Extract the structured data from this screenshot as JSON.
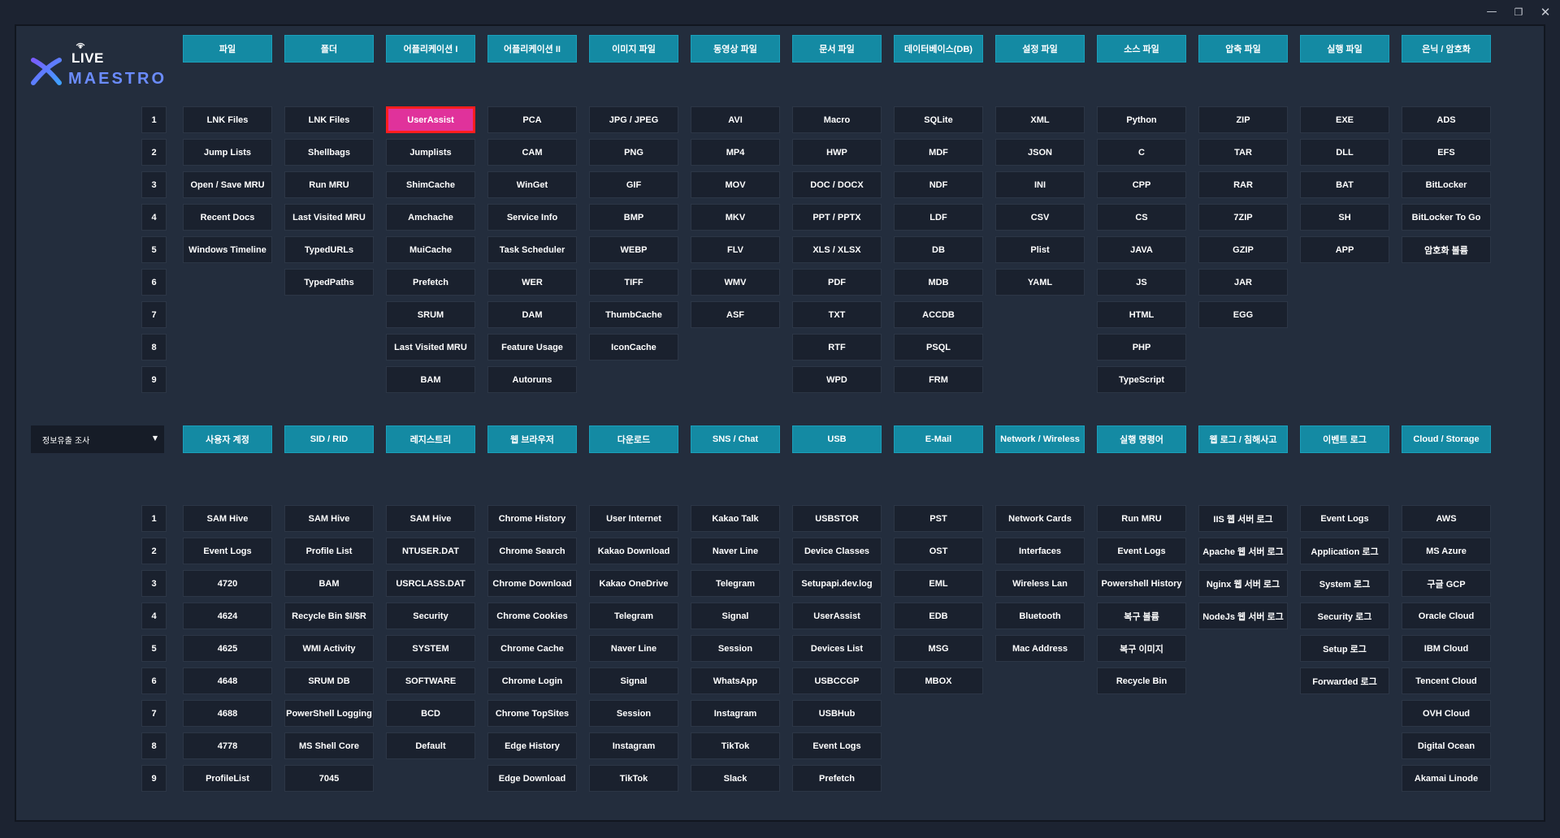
{
  "window": {
    "minimize_glyph": "—",
    "maximize_glyph": "❐",
    "close_glyph": "✕"
  },
  "logo": {
    "top_text": "LIVE",
    "bottom_text": "MAESTRO"
  },
  "top_section": {
    "headers": [
      "파일",
      "폴더",
      "어플리케이션 I",
      "어플리케이션 II",
      "이미지 파일",
      "동영상 파일",
      "문서 파일",
      "데이터베이스(DB)",
      "설정 파일",
      "소스 파일",
      "압축 파일",
      "실행 파일",
      "은닉 / 암호화"
    ],
    "row_numbers": [
      "1",
      "2",
      "3",
      "4",
      "5",
      "6",
      "7",
      "8",
      "9"
    ],
    "selected": "UserAssist",
    "columns": [
      [
        "LNK Files",
        "Jump Lists",
        "Open / Save MRU",
        "Recent Docs",
        "Windows Timeline"
      ],
      [
        "LNK Files",
        "Shellbags",
        "Run MRU",
        "Last Visited MRU",
        "TypedURLs",
        "TypedPaths"
      ],
      [
        "UserAssist",
        "Jumplists",
        "ShimCache",
        "Amchache",
        "MuiCache",
        "Prefetch",
        "SRUM",
        "Last Visited MRU",
        "BAM"
      ],
      [
        "PCA",
        "CAM",
        "WinGet",
        "Service Info",
        "Task Scheduler",
        "WER",
        "DAM",
        "Feature Usage",
        "Autoruns"
      ],
      [
        "JPG / JPEG",
        "PNG",
        "GIF",
        "BMP",
        "WEBP",
        "TIFF",
        "ThumbCache",
        "IconCache"
      ],
      [
        "AVI",
        "MP4",
        "MOV",
        "MKV",
        "FLV",
        "WMV",
        "ASF"
      ],
      [
        "Macro",
        "HWP",
        "DOC / DOCX",
        "PPT / PPTX",
        "XLS / XLSX",
        "PDF",
        "TXT",
        "RTF",
        "WPD"
      ],
      [
        "SQLite",
        "MDF",
        "NDF",
        "LDF",
        "DB",
        "MDB",
        "ACCDB",
        "PSQL",
        "FRM"
      ],
      [
        "XML",
        "JSON",
        "INI",
        "CSV",
        "Plist",
        "YAML"
      ],
      [
        "Python",
        "C",
        "CPP",
        "CS",
        "JAVA",
        "JS",
        "HTML",
        "PHP",
        "TypeScript"
      ],
      [
        "ZIP",
        "TAR",
        "RAR",
        "7ZIP",
        "GZIP",
        "JAR",
        "EGG"
      ],
      [
        "EXE",
        "DLL",
        "BAT",
        "SH",
        "APP"
      ],
      [
        "ADS",
        "EFS",
        "BitLocker",
        "BitLocker To Go",
        "암호화 볼륨"
      ]
    ]
  },
  "bottom_section": {
    "dropdown": "정보유출 조사",
    "headers": [
      "사용자 계정",
      "SID / RID",
      "레지스트리",
      "웹 브라우저",
      "다운로드",
      "SNS / Chat",
      "USB",
      "E-Mail",
      "Network / Wireless",
      "실행 명령어",
      "웹 로그 / 침해사고",
      "이벤트 로그",
      "Cloud / Storage"
    ],
    "row_numbers": [
      "1",
      "2",
      "3",
      "4",
      "5",
      "6",
      "7",
      "8",
      "9"
    ],
    "columns": [
      [
        "SAM Hive",
        "Event Logs",
        "4720",
        "4624",
        "4625",
        "4648",
        "4688",
        "4778",
        "ProfileList"
      ],
      [
        "SAM Hive",
        "Profile List",
        "BAM",
        "Recycle Bin $I/$R",
        "WMI Activity",
        "SRUM DB",
        "PowerShell Logging",
        "MS Shell Core",
        "7045"
      ],
      [
        "SAM Hive",
        "NTUSER.DAT",
        "USRCLASS.DAT",
        "Security",
        "SYSTEM",
        "SOFTWARE",
        "BCD",
        "Default"
      ],
      [
        "Chrome History",
        "Chrome Search",
        "Chrome Download",
        "Chrome Cookies",
        "Chrome Cache",
        "Chrome Login",
        "Chrome TopSites",
        "Edge History",
        "Edge Download"
      ],
      [
        "User Internet",
        "Kakao Download",
        "Kakao OneDrive",
        "Telegram",
        "Naver Line",
        "Signal",
        "Session",
        "Instagram",
        "TikTok"
      ],
      [
        "Kakao Talk",
        "Naver Line",
        "Telegram",
        "Signal",
        "Session",
        "WhatsApp",
        "Instagram",
        "TikTok",
        "Slack"
      ],
      [
        "USBSTOR",
        "Device Classes",
        "Setupapi.dev.log",
        "UserAssist",
        "Devices List",
        "USBCCGP",
        "USBHub",
        "Event Logs",
        "Prefetch"
      ],
      [
        "PST",
        "OST",
        "EML",
        "EDB",
        "MSG",
        "MBOX"
      ],
      [
        "Network Cards",
        "Interfaces",
        "Wireless Lan",
        "Bluetooth",
        "Mac Address"
      ],
      [
        "Run MRU",
        "Event Logs",
        "Powershell History",
        "복구 볼륨",
        "복구 이미지",
        "Recycle Bin"
      ],
      [
        "IIS 웹 서버 로그",
        "Apache 웹 서버 로그",
        "Nginx 웹 서버 로그",
        "NodeJs 웹 서버 로그"
      ],
      [
        "Event Logs",
        "Application 로그",
        "System 로그",
        "Security 로그",
        "Setup 로그",
        "Forwarded 로그"
      ],
      [
        "AWS",
        "MS Azure",
        "구글 GCP",
        "Oracle Cloud",
        "IBM Cloud",
        "Tencent Cloud",
        "OVH Cloud",
        "Digital Ocean",
        "Akamai Linode"
      ]
    ]
  }
}
